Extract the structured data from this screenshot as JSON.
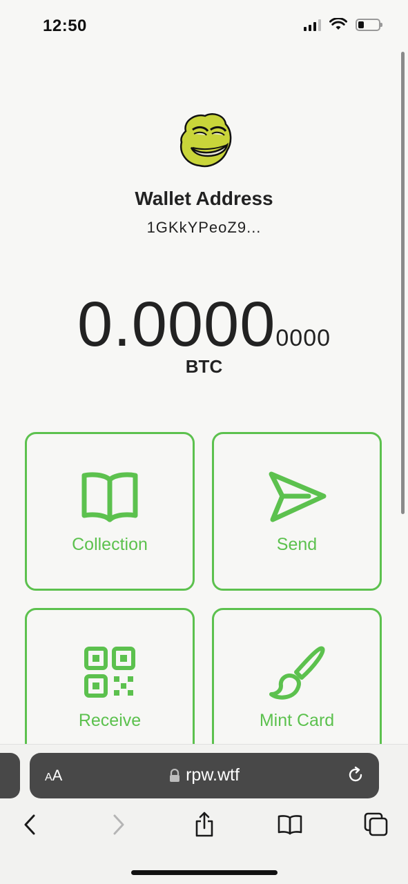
{
  "status_bar": {
    "time": "12:50"
  },
  "wallet": {
    "title": "Wallet Address",
    "address": "1GKkYPeoZ9...",
    "balance_main": "0.0000",
    "balance_sub": "0000",
    "currency": "BTC"
  },
  "actions": [
    {
      "label": "Collection",
      "icon": "book-icon"
    },
    {
      "label": "Send",
      "icon": "send-icon"
    },
    {
      "label": "Receive",
      "icon": "qr-code-icon"
    },
    {
      "label": "Mint Card",
      "icon": "paintbrush-icon"
    }
  ],
  "browser": {
    "aa_label_small": "A",
    "aa_label_large": "A",
    "url": "rpw.wtf"
  },
  "colors": {
    "accent": "#5cc14e",
    "background": "#f7f7f5",
    "url_bar": "#484848"
  }
}
